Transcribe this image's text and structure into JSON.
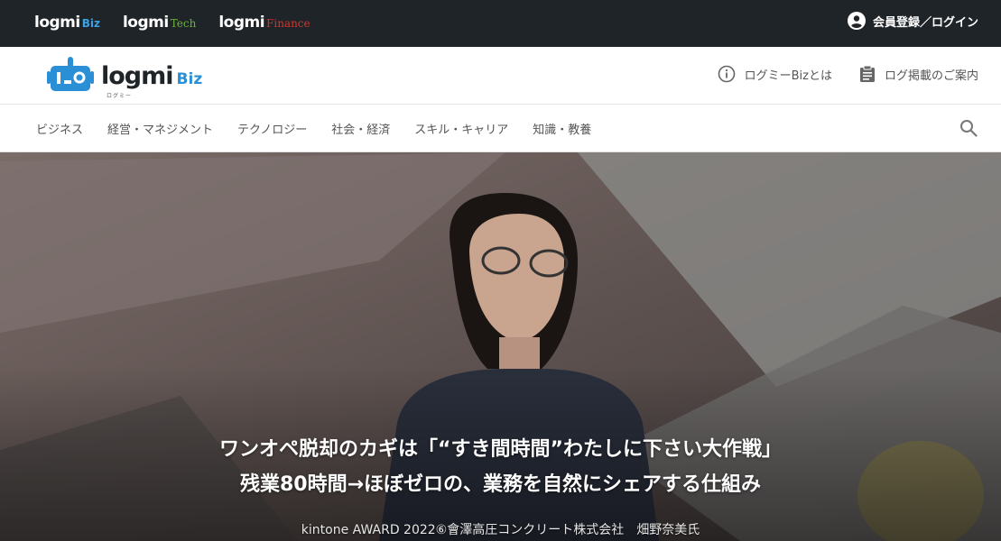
{
  "topbar": {
    "sites": [
      {
        "main": "logmi",
        "sub": "Biz"
      },
      {
        "main": "logmi",
        "sub": "Tech"
      },
      {
        "main": "logmi",
        "sub": "Finance"
      }
    ],
    "login_label": "会員登録／ログイン"
  },
  "header": {
    "brand_word": "logmi",
    "brand_sub": "Biz",
    "brand_kana": "ログミー",
    "links": [
      {
        "label": "ログミーBizとは",
        "icon": "info-icon"
      },
      {
        "label": "ログ掲載のご案内",
        "icon": "clipboard-icon"
      }
    ]
  },
  "nav": {
    "categories": [
      "ビジネス",
      "経営・マネジメント",
      "テクノロジー",
      "社会・経済",
      "スキル・キャリア",
      "知識・教養"
    ]
  },
  "hero": {
    "title_line1": "ワンオペ脱却のカギは「“すき間時間”わたしに下さい大作戦」",
    "title_line2": "残業80時間→ほぼゼロの、業務を自然にシェアする仕組み",
    "byline": "kintone AWARD 2022⑥會澤高圧コンクリート株式会社　畑野奈美氏"
  },
  "colors": {
    "topbar_bg": "#1f2428",
    "biz_blue": "#2b8fd6",
    "tech_green": "#6bb33a",
    "finance_red": "#d2352f"
  }
}
